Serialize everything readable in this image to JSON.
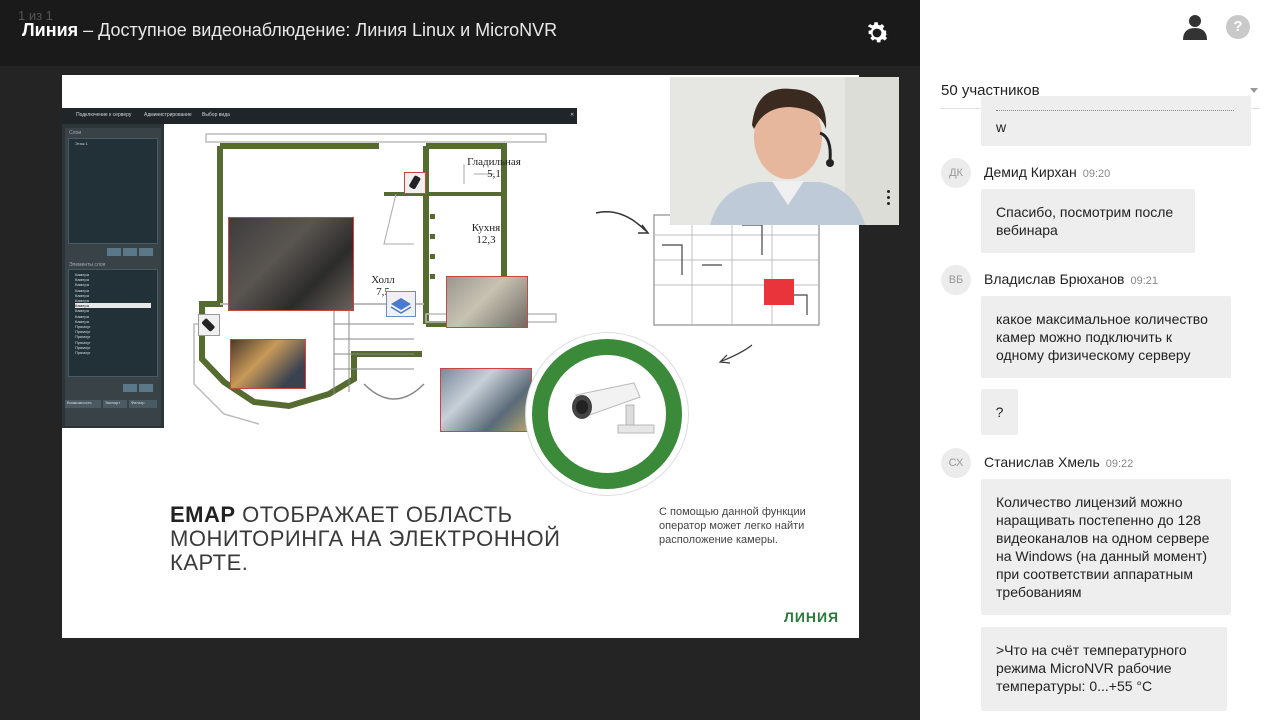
{
  "header": {
    "page_counter": "1 из 1",
    "brand": "Линия",
    "title_rest": " – Доступное видеонаблюдение: Линия Linux и MicroNVR",
    "settings_icon": "gear-icon"
  },
  "slide": {
    "app_toolbar": [
      "Подключение к серверу",
      "Администрирование",
      "Выбор вида"
    ],
    "app_panel_top_label": "Слои",
    "app_panel_top_item": "Этаж 1",
    "app_panel_bottom_label": "Элементы слоя",
    "app_list_items": [
      "Камера",
      "Камера",
      "Камера",
      "Камера",
      "Камера",
      "Камера",
      "Камера",
      "Камера",
      "Камера",
      "Камера",
      "Прямоуг",
      "Прямоуг",
      "Прямоуг",
      "Прямоуг",
      "Прямоуг",
      "Прямоуг"
    ],
    "app_bottom_buttons": [
      "Возможность",
      "Экспорт",
      "Фильтр"
    ],
    "rooms": [
      {
        "name": "Гладильная",
        "area": "5,1"
      },
      {
        "name": "Кухня",
        "area": "12,3"
      },
      {
        "name": "Холл",
        "area": "7,5"
      }
    ],
    "headline_bold": "EMAP",
    "headline_rest": " ОТОБРАЖАЕТ ОБЛАСТЬ МОНИТОРИНГА НА ЭЛЕКТРОННОЙ КАРТЕ.",
    "caption": "С помощью данной функции оператор может легко найти расположение камеры.",
    "logo": "ЛИНИЯ"
  },
  "chat": {
    "participants": "50 участников",
    "prev_tail": "w",
    "messages": [
      {
        "initials": "ДК",
        "author": "Демид Кирхан",
        "time": "09:20",
        "bubbles": [
          "Спасибо, посмотрим после вебинара"
        ]
      },
      {
        "initials": "ВБ",
        "author": "Владислав Брюханов",
        "time": "09:21",
        "bubbles": [
          "какое максимальное количество камер можно подключить к одному физическому серверу",
          "?"
        ]
      },
      {
        "initials": "СХ",
        "author": "Станислав Хмель",
        "time": "09:22",
        "bubbles": [
          "Количество лицензий можно наращивать постепенно до 128 видеоканалов на одном сервере на Windows (на данный момент) при соответствии аппаратным требованиям",
          ">Что на счёт температурного режима MicroNVR рабочие температуры: 0...+55 °C"
        ]
      }
    ]
  }
}
